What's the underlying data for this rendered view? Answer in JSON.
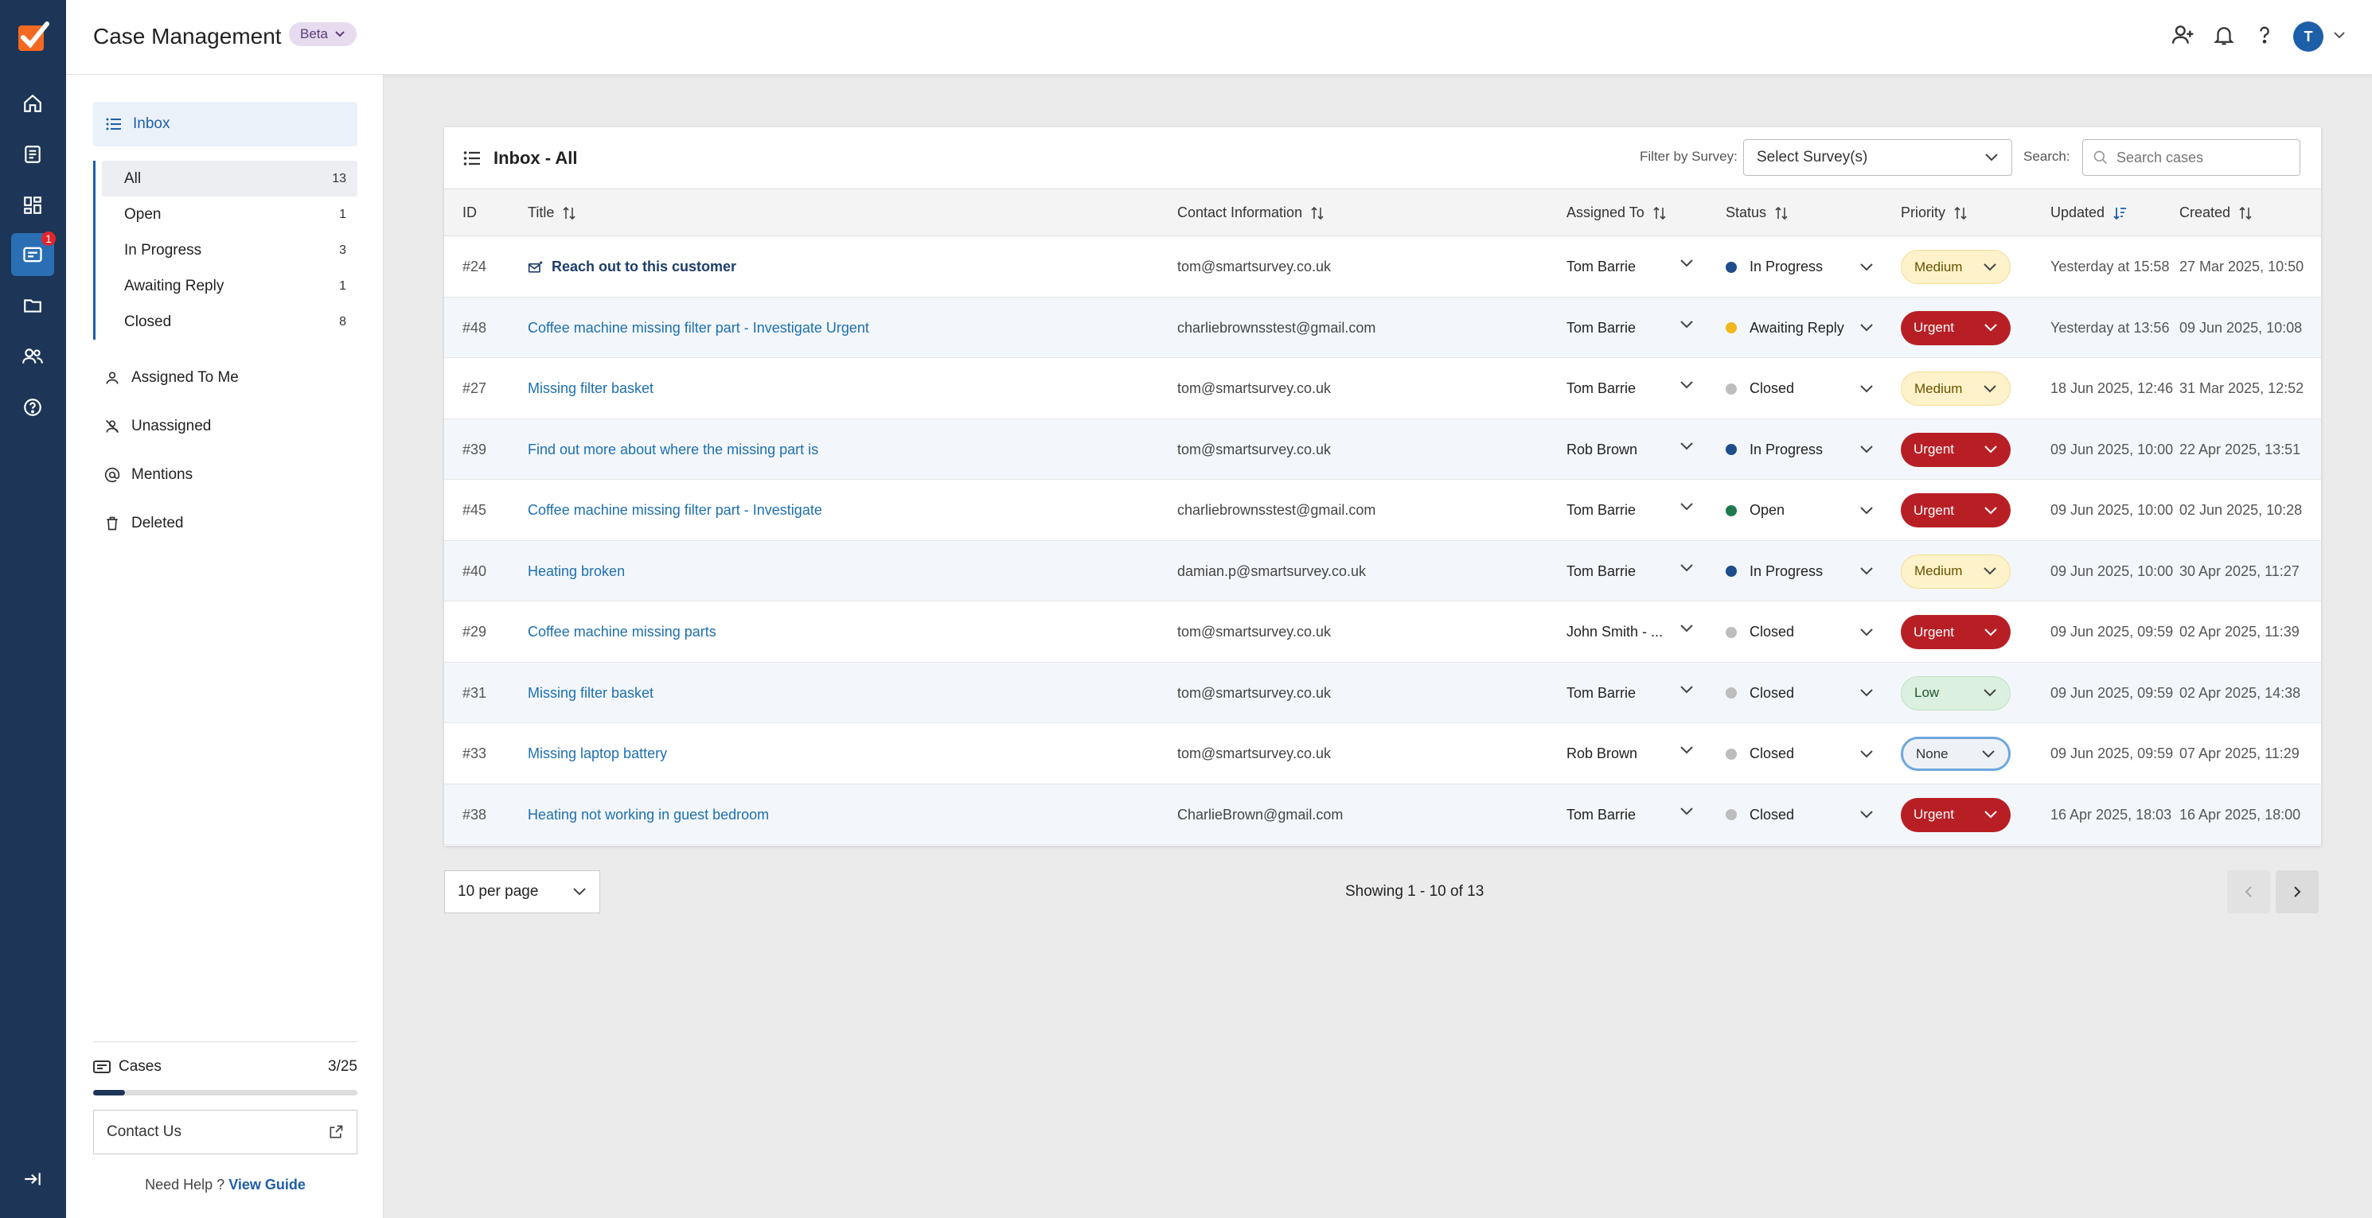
{
  "header": {
    "title": "Case Management",
    "badge": "Beta",
    "avatar_initial": "T",
    "icons": [
      "add-user-icon",
      "bell-icon",
      "help-icon"
    ]
  },
  "rail": {
    "badge": "1",
    "icons": [
      "home-icon",
      "surveys-icon",
      "dashboard-icon",
      "cases-icon",
      "folder-icon",
      "contacts-icon",
      "help-circle-icon",
      "collapse-icon"
    ]
  },
  "sidebar": {
    "inbox_label": "Inbox",
    "sub_items": [
      {
        "label": "All",
        "count": "13"
      },
      {
        "label": "Open",
        "count": "1"
      },
      {
        "label": "In Progress",
        "count": "3"
      },
      {
        "label": "Awaiting Reply",
        "count": "1"
      },
      {
        "label": "Closed",
        "count": "8"
      }
    ],
    "nav": [
      {
        "label": "Assigned To Me",
        "icon": "user-icon"
      },
      {
        "label": "Unassigned",
        "icon": "user-off-icon"
      },
      {
        "label": "Mentions",
        "icon": "at-icon"
      },
      {
        "label": "Deleted",
        "icon": "trash-icon"
      }
    ],
    "cases_label": "Cases",
    "cases_value": "3/25",
    "cases_fraction": 0.12,
    "contact_label": "Contact Us",
    "help_text": "Need Help ?",
    "help_link": "View Guide"
  },
  "main": {
    "title": "Inbox - All",
    "filter_label": "Filter by Survey:",
    "survey_placeholder": "Select Survey(s)",
    "search_label": "Search:",
    "search_placeholder": "Search cases",
    "columns": {
      "id": "ID",
      "title": "Title",
      "contact": "Contact Information",
      "assigned": "Assigned To",
      "status": "Status",
      "priority": "Priority",
      "updated": "Updated",
      "created": "Created"
    },
    "rows": [
      {
        "id": "#24",
        "title": "Reach out to this customer",
        "contact": "tom@smartsurvey.co.uk",
        "assigned": "Tom Barrie",
        "status": "In Progress",
        "priority": "Medium",
        "updated": "Yesterday at 15:58",
        "created": "27 Mar 2025, 10:50"
      },
      {
        "id": "#48",
        "title": "Coffee machine missing filter part - Investigate Urgent",
        "contact": "charliebrownsstest@gmail.com",
        "assigned": "Tom Barrie",
        "status": "Awaiting Reply",
        "priority": "Urgent",
        "updated": "Yesterday at 13:56",
        "created": "09 Jun 2025, 10:08"
      },
      {
        "id": "#27",
        "title": "Missing filter basket",
        "contact": "tom@smartsurvey.co.uk",
        "assigned": "Tom Barrie",
        "status": "Closed",
        "priority": "Medium",
        "updated": "18 Jun 2025, 12:46",
        "created": "31 Mar 2025, 12:52"
      },
      {
        "id": "#39",
        "title": "Find out more about where the missing part is",
        "contact": "tom@smartsurvey.co.uk",
        "assigned": "Rob Brown",
        "status": "In Progress",
        "priority": "Urgent",
        "updated": "09 Jun 2025, 10:00",
        "created": "22 Apr 2025, 13:51"
      },
      {
        "id": "#45",
        "title": "Coffee machine missing filter part - Investigate",
        "contact": "charliebrownsstest@gmail.com",
        "assigned": "Tom Barrie",
        "status": "Open",
        "priority": "Urgent",
        "updated": "09 Jun 2025, 10:00",
        "created": "02 Jun 2025, 10:28"
      },
      {
        "id": "#40",
        "title": "Heating broken",
        "contact": "damian.p@smartsurvey.co.uk",
        "assigned": "Tom Barrie",
        "status": "In Progress",
        "priority": "Medium",
        "updated": "09 Jun 2025, 10:00",
        "created": "30 Apr 2025, 11:27"
      },
      {
        "id": "#29",
        "title": "Coffee machine missing parts",
        "contact": "tom@smartsurvey.co.uk",
        "assigned": "John Smith - ...",
        "status": "Closed",
        "priority": "Urgent",
        "updated": "09 Jun 2025, 09:59",
        "created": "02 Apr 2025, 11:39"
      },
      {
        "id": "#31",
        "title": "Missing filter basket",
        "contact": "tom@smartsurvey.co.uk",
        "assigned": "Tom Barrie",
        "status": "Closed",
        "priority": "Low",
        "updated": "09 Jun 2025, 09:59",
        "created": "02 Apr 2025, 14:38"
      },
      {
        "id": "#33",
        "title": "Missing laptop battery",
        "contact": "tom@smartsurvey.co.uk",
        "assigned": "Rob Brown",
        "status": "Closed",
        "priority": "None",
        "updated": "09 Jun 2025, 09:59",
        "created": "07 Apr 2025, 11:29"
      },
      {
        "id": "#38",
        "title": "Heating not working in guest bedroom",
        "contact": "CharlieBrown@gmail.com",
        "assigned": "Tom Barrie",
        "status": "Closed",
        "priority": "Urgent",
        "updated": "16 Apr 2025, 18:03",
        "created": "16 Apr 2025, 18:00"
      }
    ],
    "status_colors": {
      "In Progress": "#1d4e89",
      "Awaiting Reply": "#f2b61e",
      "Closed": "#bdbdbd",
      "Open": "#1e7a4d"
    },
    "per_page": "10 per page",
    "showing": "Showing 1 - 10 of 13"
  }
}
